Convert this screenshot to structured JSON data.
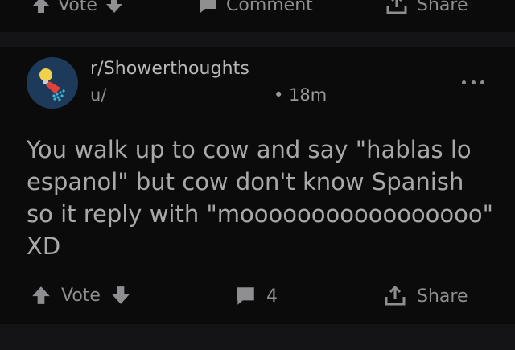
{
  "prev_actions": {
    "vote_label": "Vote",
    "comment_label": "Comment",
    "share_label": "Share"
  },
  "post": {
    "subreddit": "r/Showerthoughts",
    "author": "u/",
    "timestamp": "• 18m",
    "title": "You walk up to cow and say \"hablas lo espanol\" but cow don't know Spanish so it reply with \"mooooooooooooooooo\" XD",
    "avatar_icon": "lightbulb-shower-icon"
  },
  "actions": {
    "vote_label": "Vote",
    "comment_count": "4",
    "share_label": "Share"
  },
  "colors": {
    "background": "#0b0b0c",
    "divider": "#141416",
    "text": "#a9a9ab",
    "avatar_bg": "#1d3a5a"
  }
}
